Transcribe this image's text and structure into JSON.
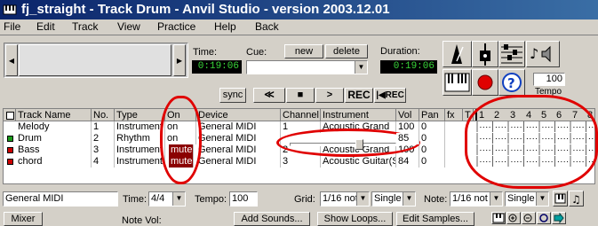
{
  "window": {
    "title": "fj_straight - Track Drum - Anvil Studio - version 2003.12.01"
  },
  "menu": [
    "File",
    "Edit",
    "Track",
    "View",
    "Practice",
    "Help",
    "Back"
  ],
  "transport": {
    "time_label": "Time:",
    "time_value": "0:19:06",
    "cue_label": "Cue:",
    "new_label": "new",
    "delete_label": "delete",
    "duration_label": "Duration:",
    "duration_value": "0:19:06",
    "sync_label": "sync",
    "rewind_symbol": "≪",
    "stop_symbol": "■",
    "play_symbol": ">",
    "rec_label": "REC",
    "rec_back_label": "|◀REC",
    "tempo_value": "100",
    "tempo_label": "Tempo"
  },
  "track_table": {
    "columns": [
      "Track Name",
      "No.",
      "Type",
      "On",
      "Device",
      "Channel",
      "Instrument",
      "Vol",
      "Pan",
      "fx",
      "T"
    ],
    "rows": [
      {
        "name": "Melody",
        "no": "1",
        "type": "Instrument",
        "on": "on",
        "device": "General MIDI",
        "channel": "1",
        "instrument": "Acoustic Grand",
        "vol": "100",
        "pan": "0",
        "color": ""
      },
      {
        "name": "Drum",
        "no": "2",
        "type": "Rhythm",
        "on": "on",
        "device": "General MIDI",
        "channel": "",
        "instrument": "",
        "vol": "85",
        "pan": "0",
        "color": "#1a9a1a"
      },
      {
        "name": "Bass",
        "no": "3",
        "type": "Instrument",
        "on": "mute",
        "device": "General MIDI",
        "channel": "2",
        "instrument": "Acoustic Grand",
        "vol": "100",
        "pan": "0",
        "color": "#cc0000"
      },
      {
        "name": "chord",
        "no": "4",
        "type": "Instrument",
        "on": "mute",
        "device": "General MIDI",
        "channel": "3",
        "instrument": "Acoustic Guitar(S",
        "vol": "84",
        "pan": "0",
        "color": "#cc0000"
      }
    ],
    "measures": [
      "1",
      "2",
      "3",
      "4",
      "5",
      "6",
      "7",
      "8"
    ],
    "volume_slider_value": 85
  },
  "bottom_bar": {
    "device_value": "General MIDI",
    "time_label": "Time:",
    "time_sig": "4/4",
    "tempo_label": "Tempo:",
    "tempo_value": "100",
    "grid_label": "Grid:",
    "grid_value": "1/16 not",
    "grid_mode": "Single",
    "note_label": "Note:",
    "note_value": "1/16 not",
    "note_mode": "Single"
  },
  "footer": {
    "mixer_label": "Mixer",
    "note_vol_label": "Note Vol:",
    "add_sounds_label": "Add Sounds...",
    "show_loops_label": "Show Loops...",
    "edit_samples_label": "Edit Samples..."
  },
  "colors": {
    "title_bar": "#0a246a",
    "lcd_text": "#3ad63a",
    "mute_bg": "#8b0000",
    "annotation": "#e00000"
  }
}
